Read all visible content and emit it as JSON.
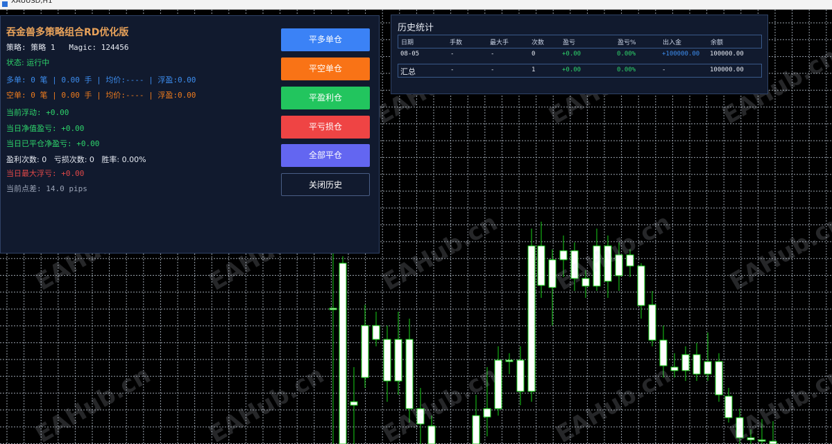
{
  "window": {
    "title": "XAUUSD,H1"
  },
  "colors": {
    "bull": "#ffffff",
    "wick": "#19d219",
    "grid": "#9aa3ad",
    "panel_bg": "#111a2e",
    "accent": "#e8a25a"
  },
  "panel": {
    "title": "吞金兽多策略组合RD优化版",
    "strategy_line": "策略: 策略 1   Magic: 124456",
    "status": "状态: 运行中",
    "long_line": "多单: 0 笔 | 0.00 手 | 均价:---- | 浮盈:0.00",
    "short_line": "空单: 0 笔 | 0.00 手 | 均价:---- | 浮盈:0.00",
    "current_float": "当前浮动: +0.00",
    "day_equity": "当日净值盈亏: +0.00",
    "day_closed": "当日已平仓净盈亏: +0.00",
    "counts": "盈利次数: 0   亏损次数: 0   胜率: 0.00%",
    "max_float": "当日最大浮亏: +0.00",
    "spread": "当前点差: 14.0 pips"
  },
  "buttons": {
    "close_long": "平多单仓",
    "close_short": "平空单仓",
    "close_profit": "平盈利仓",
    "close_loss": "平亏损仓",
    "close_all": "全部平仓",
    "close_history": "关闭历史"
  },
  "history": {
    "title": "历史统计",
    "columns": [
      "日期",
      "手数",
      "最大手",
      "次数",
      "盈亏",
      "盈亏%",
      "出入金",
      "余额"
    ],
    "rows": [
      [
        "08-05",
        "-",
        "-",
        "0",
        "+0.00",
        "0.00%",
        "+100000.00",
        "100000.00"
      ]
    ],
    "summary": [
      "汇总",
      "-",
      "-",
      "1",
      "+0.00",
      "0.00%",
      "-",
      "100000.00"
    ]
  },
  "watermark": "EAHub.cn",
  "candles": [
    [
      480,
      360,
      445,
      360,
      641
    ],
    [
      494,
      370,
      380,
      641,
      641
    ],
    [
      510,
      530,
      580,
      585,
      641
    ],
    [
      526,
      440,
      470,
      545,
      560
    ],
    [
      542,
      450,
      470,
      490,
      500
    ],
    [
      558,
      470,
      490,
      550,
      580
    ],
    [
      574,
      450,
      490,
      550,
      570
    ],
    [
      590,
      460,
      490,
      590,
      610
    ],
    [
      606,
      560,
      590,
      612,
      641
    ],
    [
      622,
      600,
      615,
      641,
      641
    ],
    [
      686,
      570,
      600,
      641,
      641
    ],
    [
      702,
      530,
      590,
      602,
      630
    ],
    [
      718,
      500,
      520,
      590,
      600
    ],
    [
      734,
      510,
      520,
      521,
      540
    ],
    [
      750,
      500,
      520,
      565,
      585
    ],
    [
      766,
      330,
      355,
      565,
      580
    ],
    [
      780,
      320,
      355,
      412,
      430
    ],
    [
      796,
      360,
      375,
      415,
      470
    ],
    [
      812,
      340,
      362,
      375,
      400
    ],
    [
      828,
      350,
      362,
      402,
      420
    ],
    [
      844,
      390,
      402,
      413,
      430
    ],
    [
      860,
      330,
      355,
      413,
      420
    ],
    [
      876,
      340,
      355,
      406,
      430
    ],
    [
      892,
      350,
      368,
      398,
      420
    ],
    [
      908,
      360,
      368,
      384,
      400
    ],
    [
      924,
      380,
      384,
      441,
      460
    ],
    [
      940,
      420,
      440,
      491,
      500
    ],
    [
      956,
      470,
      491,
      528,
      545
    ],
    [
      972,
      510,
      530,
      535,
      545
    ],
    [
      988,
      500,
      512,
      535,
      550
    ],
    [
      1004,
      495,
      512,
      540,
      550
    ],
    [
      1020,
      480,
      522,
      540,
      550
    ],
    [
      1036,
      510,
      522,
      570,
      580
    ],
    [
      1050,
      560,
      572,
      603,
      610
    ],
    [
      1066,
      590,
      603,
      632,
      641
    ],
    [
      1082,
      620,
      632,
      635,
      641
    ],
    [
      1098,
      605,
      635,
      637,
      641
    ],
    [
      1114,
      608,
      637,
      641,
      641
    ]
  ]
}
